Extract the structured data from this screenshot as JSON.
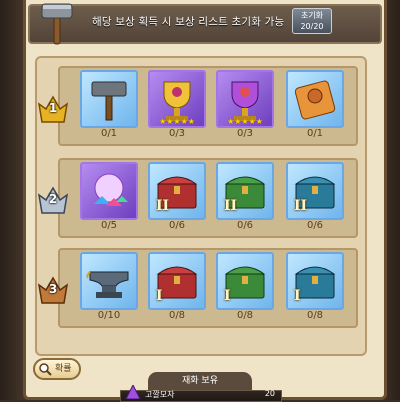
{
  "header": {
    "info_text": "해당 보상 획득 시 보상 리스트 초기화 가능",
    "reset_label": "초기화",
    "reset_count": "20/20"
  },
  "tiers": [
    {
      "rank": "1",
      "items": [
        {
          "icon": "hammer-icon",
          "count": "0/1"
        },
        {
          "icon": "trophy-icon",
          "count": "0/3"
        },
        {
          "icon": "trophy-icon",
          "count": "0/3"
        },
        {
          "icon": "cookie-box-icon",
          "count": "0/1"
        }
      ]
    },
    {
      "rank": "2",
      "items": [
        {
          "icon": "jewel-pile-icon",
          "count": "0/5"
        },
        {
          "icon": "chest-red-icon",
          "tier": "II",
          "count": "0/6"
        },
        {
          "icon": "chest-green-icon",
          "tier": "II",
          "count": "0/6"
        },
        {
          "icon": "chest-blue-icon",
          "tier": "II",
          "count": "0/6"
        }
      ]
    },
    {
      "rank": "3",
      "items": [
        {
          "icon": "anvil-icon",
          "count": "0/10"
        },
        {
          "icon": "chest-red-icon",
          "tier": "I",
          "count": "0/8"
        },
        {
          "icon": "chest-green-icon",
          "tier": "I",
          "count": "0/8"
        },
        {
          "icon": "chest-blue-icon",
          "tier": "I",
          "count": "0/8"
        }
      ]
    }
  ],
  "footer": {
    "probability_label": "확률",
    "holding_label": "재화 보유",
    "currency_name": "고깔모자",
    "currency_value": "20"
  },
  "colors": {
    "panel": "#efe3c8",
    "row": "#cdb990",
    "gold": "#e6b422",
    "silver": "#b8c4d2",
    "bronze": "#c07a3a"
  }
}
